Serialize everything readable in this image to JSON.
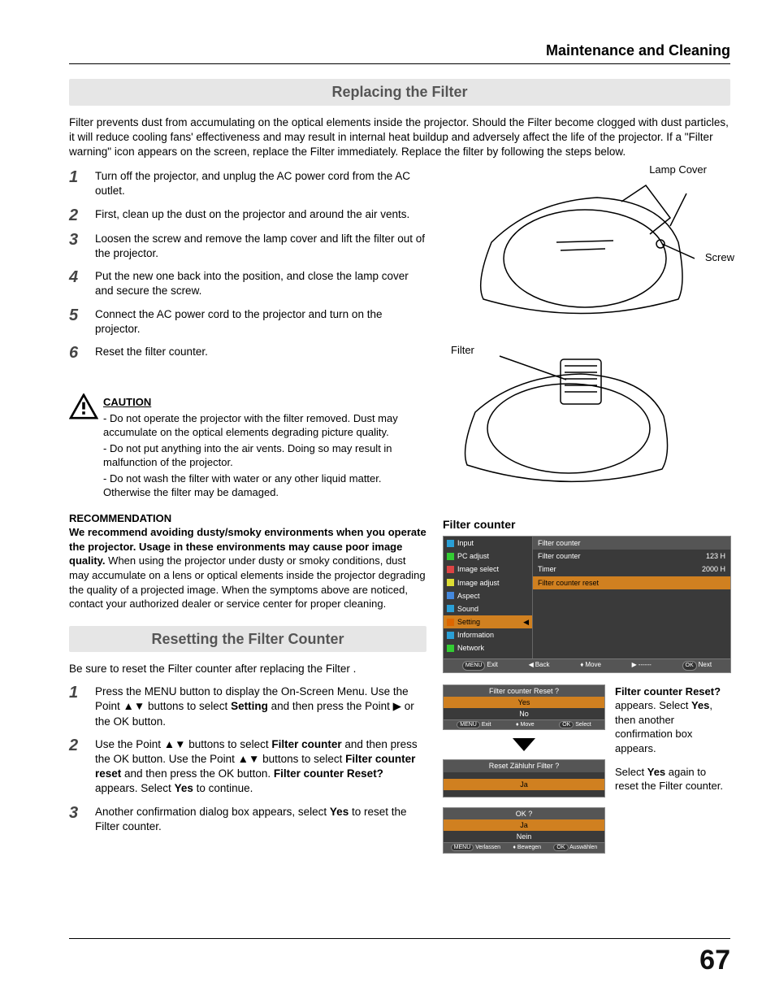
{
  "chapter": "Maintenance and Cleaning",
  "section1_title": "Replacing the Filter",
  "intro": "Filter prevents dust from accumulating on the optical elements inside the projector. Should the Filter  become clogged with dust particles, it will reduce cooling fans' effectiveness and may result in internal heat buildup and adversely affect the life of the projector. If a \"Filter warning\" icon appears on the screen, replace the Filter immediately. Replace the filter by following the steps below.",
  "steps1": [
    "Turn off the projector, and unplug the AC power cord from the AC outlet.",
    "First, clean up the dust on the projector and around the air vents.",
    "Loosen the screw and remove the lamp cover and lift the filter out of the projector.",
    "Put the new one back into the position, and close the lamp cover and secure the screw.",
    "Connect the AC power cord to the projector and turn on the projector.",
    "Reset the filter counter."
  ],
  "caution_title": "CAUTION",
  "cautions": [
    "Do not operate the projector with the filter removed. Dust may accumulate on the optical elements degrading picture quality.",
    "Do not put anything into the air vents. Doing so may result in malfunction of the projector.",
    "Do not wash the filter with water or any other liquid matter. Otherwise the filter may be damaged."
  ],
  "recommend_title": "RECOMMENDATION",
  "recommend_bold": "We recommend avoiding dusty/smoky environments when you operate the projector. Usage in these environments may cause poor image quality.",
  "recommend_body": "When using the projector under dusty or smoky conditions, dust may accumulate on a lens or optical elements inside the projector degrading the quality of a projected image. When the symptoms above are noticed, contact your authorized dealer or service center for proper cleaning.",
  "section2_title": "Resetting the Filter Counter",
  "sub_intro": "Be sure to reset the Filter counter after replacing the Filter .",
  "steps2": {
    "s1_a": "Press the MENU button to display the On-Screen Menu. Use the Point ▲▼ buttons to select ",
    "s1_b": "Setting",
    "s1_c": " and then press the Point ▶ or the OK button.",
    "s2_a": "Use the Point ▲▼ buttons to select ",
    "s2_b": "Filter counter",
    "s2_c": " and then press the OK button. Use the Point ▲▼ buttons to select ",
    "s2_d": "Filter counter reset",
    "s2_e": " and then press the OK button. ",
    "s2_f": "Filter counter Reset?",
    "s2_g": " appears. Select ",
    "s2_h": "Yes",
    "s2_i": " to continue.",
    "s3_a": "Another confirmation dialog box appears, select ",
    "s3_b": "Yes",
    "s3_c": " to reset the Filter counter."
  },
  "labels": {
    "lamp_cover": "Lamp Cover",
    "screw": "Screw",
    "filter": "Filter",
    "filter_counter": "Filter counter"
  },
  "menu": {
    "side": [
      "Input",
      "PC adjust",
      "Image select",
      "Image adjust",
      "Aspect",
      "Sound",
      "Setting",
      "Information",
      "Network"
    ],
    "title": "Filter counter",
    "rows": [
      {
        "l": "Filter counter",
        "r": "123 H"
      },
      {
        "l": "Timer",
        "r": "2000 H"
      },
      {
        "l": "Filter counter reset",
        "r": ""
      }
    ],
    "footer": [
      "Exit",
      "Back",
      "Move",
      "------",
      "Next"
    ],
    "footer_keys": [
      "MENU",
      "◀",
      "♦",
      "▶",
      "OK"
    ]
  },
  "dialog1": {
    "title": "Filter counter Reset ?",
    "opts": [
      "Yes",
      "No"
    ],
    "foot": [
      "Exit",
      "Move",
      "Select"
    ],
    "foot_keys": [
      "MENU",
      "♦",
      "OK"
    ]
  },
  "dialog2": {
    "title": "Reset Zähluhr Filter ?",
    "opts": [
      "Ja"
    ]
  },
  "dialog3": {
    "title": "OK ?",
    "opts": [
      "Ja",
      "Nein"
    ],
    "foot": [
      "Verlassen",
      "Bewegen",
      "Auswählen"
    ],
    "foot_keys": [
      "MENU",
      "♦",
      "OK"
    ]
  },
  "note1_a": "Filter counter Reset?",
  "note1_b": " appears. Select ",
  "note1_c": "Yes",
  "note1_d": ", then another confirmation box appears.",
  "note2_a": "Select ",
  "note2_b": "Yes",
  "note2_c": " again to reset the Filter counter.",
  "page": "67"
}
